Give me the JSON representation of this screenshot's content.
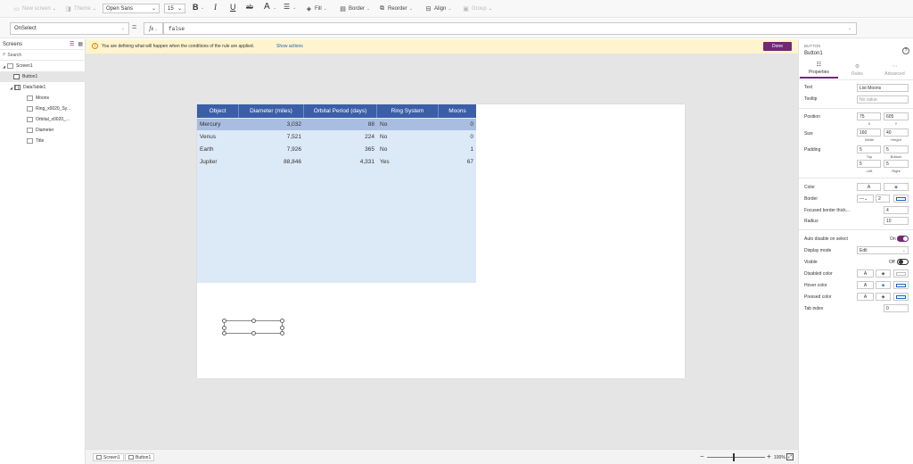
{
  "toolbar": {
    "new_screen": "New screen",
    "theme": "Theme",
    "font": "Open Sans",
    "font_size": "15",
    "fill": "Fill",
    "border": "Border",
    "reorder": "Reorder",
    "align": "Align",
    "group": "Group"
  },
  "formula": {
    "property": "OnSelect",
    "fx": "fx",
    "value": "false"
  },
  "left_panel": {
    "title": "Screens",
    "search_placeholder": "Search",
    "tree": [
      {
        "label": "Screen1"
      },
      {
        "label": "Button1"
      },
      {
        "label": "DataTable1"
      },
      {
        "label": "Moons"
      },
      {
        "label": "Ring_x0020_Sy..."
      },
      {
        "label": "Orbital_x0020_..."
      },
      {
        "label": "Diameter"
      },
      {
        "label": "Title"
      }
    ]
  },
  "warning": {
    "text": "You are defining what will happen when the conditions of the rule are applied.",
    "link": "Show actions",
    "done": "Done"
  },
  "table": {
    "headers": [
      "Object",
      "Diameter (miles)",
      "Orbital Period (days)",
      "Ring System",
      "Moons"
    ],
    "rows": [
      [
        "Mercury",
        "3,032",
        "88",
        "No",
        "0"
      ],
      [
        "Venus",
        "7,521",
        "224",
        "No",
        "0"
      ],
      [
        "Earth",
        "7,926",
        "365",
        "No",
        "1"
      ],
      [
        "Jupiter",
        "88,846",
        "4,331",
        "Yes",
        "67"
      ]
    ]
  },
  "status": {
    "screen": "Screen1",
    "control": "Button1",
    "zoom": "100%",
    "zoom_fraction": 0.45
  },
  "right_panel": {
    "type": "BUTTON",
    "name": "Button1",
    "tabs": [
      "Properties",
      "Rules",
      "Advanced"
    ],
    "text_label": "Text",
    "text_value": "List Moons",
    "tooltip_label": "Tooltip",
    "tooltip_placeholder": "No value",
    "position_label": "Position",
    "x": "75",
    "y": "605",
    "x_label": "X",
    "y_label": "Y",
    "size_label": "Size",
    "width": "160",
    "height": "40",
    "width_label": "Width",
    "height_label": "Height",
    "padding_label": "Padding",
    "pad_top": "5",
    "pad_bottom": "5",
    "pad_left": "5",
    "pad_right": "5",
    "top_label": "Top",
    "bottom_label": "Bottom",
    "left_label": "Left",
    "right_label": "Right",
    "color_label": "Color",
    "border_label": "Border",
    "border_width": "2",
    "focused_label": "Focused border thick...",
    "focused_value": "4",
    "radius_label": "Radius",
    "radius_value": "10",
    "auto_disable_label": "Auto disable on select",
    "auto_disable_value": "On",
    "display_mode_label": "Display mode",
    "display_mode_value": "Edit",
    "visible_label": "Visible",
    "visible_value": "Off",
    "disabled_color_label": "Disabled color",
    "hover_color_label": "Hover color",
    "pressed_color_label": "Pressed color",
    "tab_index_label": "Tab index",
    "tab_index_value": "0",
    "letter_a": "A"
  },
  "colors": {
    "accent": "#742774",
    "table_header": "#3b5ea8",
    "table_body": "#dce9f7",
    "warning_bg": "#fff4ce"
  }
}
